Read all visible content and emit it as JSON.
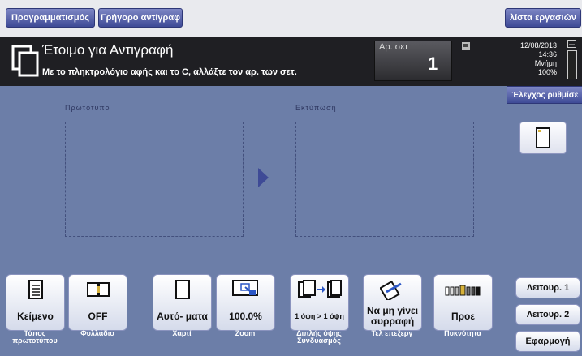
{
  "tabs": {
    "programs": "Προγραμματισμός",
    "quick_copy": "Γρήγορο αντίγραφ",
    "job_list": "λίστα εργασιών"
  },
  "status": {
    "title": "Έτοιμο για Αντιγραφή",
    "subtitle": "Με το πληκτρολόγιο αφής και το C, αλλάξτε τον αρ. των σετ.",
    "sets_label": "Αρ. σετ",
    "sets_value": "1",
    "date": "12/08/2013",
    "time": "14:36",
    "memory_label": "Μνήμη",
    "memory_value": "100%",
    "check_settings": "Έλεγχος ρυθμίσε"
  },
  "main": {
    "original_label": "Πρωτότυπο",
    "output_label": "Εκτύπωση"
  },
  "functions": [
    {
      "value": "Κείμενο",
      "caption": "Τύπος πρωτοτύπου",
      "icon": "document-text-icon"
    },
    {
      "value": "OFF",
      "caption": "Φυλλάδιο",
      "icon": "booklet-icon"
    },
    {
      "value": "Αυτό- ματα",
      "caption": "Χαρτί",
      "icon": "paper-icon"
    },
    {
      "value": "100.0%",
      "caption": "Zoom",
      "icon": "zoom-icon"
    },
    {
      "value": "1 όψη > 1 όψη",
      "caption": "Διπλής όψης Συνδυασμός",
      "icon": "duplex-icon"
    },
    {
      "value": "Να μη γίνει συρραφή",
      "caption": "Τελ επεξεργ",
      "icon": "stapler-icon"
    },
    {
      "value": "Προε",
      "caption": "Πυκνότητα",
      "icon": "density-icon"
    }
  ],
  "side": {
    "func1": "Λειτουρ. 1",
    "func2": "Λειτουρ. 2",
    "apply": "Εφαρμογή"
  }
}
